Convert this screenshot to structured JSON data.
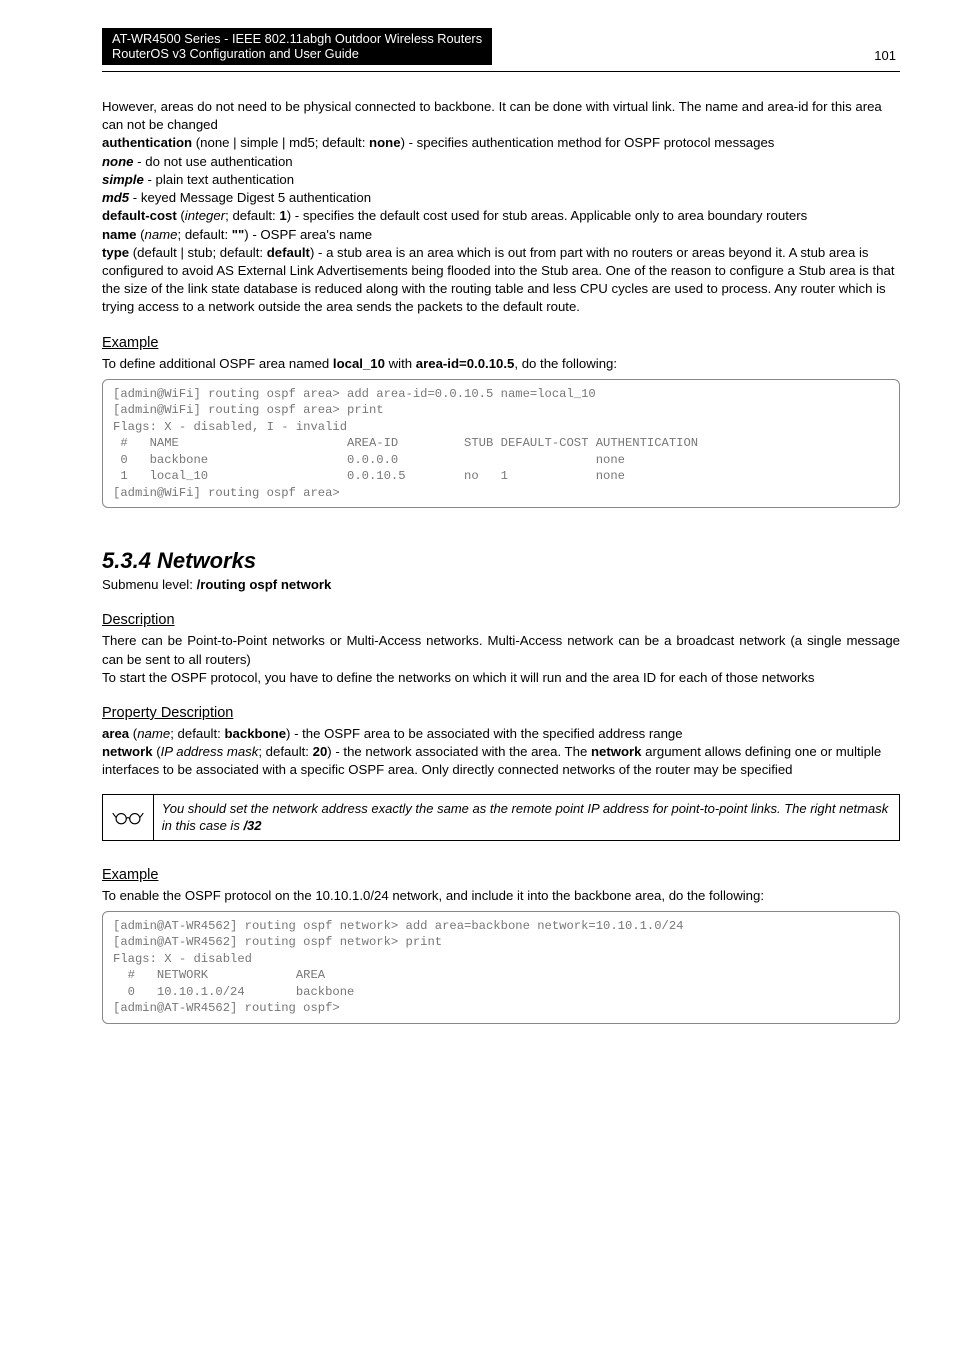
{
  "header": {
    "line1": "AT-WR4500 Series - IEEE 802.11abgh Outdoor Wireless Routers",
    "line2": "RouterOS v3 Configuration and User Guide",
    "page_number": "101"
  },
  "intro": {
    "p1": "However, areas do not need to be physical connected to backbone. It can be done with virtual link. The name and area-id for this area can not be changed",
    "auth_label": "authentication",
    "auth_rest": " (none | simple | md5; default: ",
    "auth_default": "none",
    "auth_tail": ") - specifies authentication method for OSPF protocol messages",
    "none_k": "none",
    "none_d": " - do not use authentication",
    "simple_k": "simple",
    "simple_d": " - plain text authentication",
    "md5_k": "md5",
    "md5_d": " - keyed Message Digest 5 authentication",
    "defcost_label": "default-cost",
    "defcost_mid1": " (",
    "defcost_type": "integer",
    "defcost_mid2": "; default: ",
    "defcost_def": "1",
    "defcost_tail": ") - specifies the default cost used for stub areas. Applicable only to area boundary routers",
    "name_label": "name",
    "name_mid1": " (",
    "name_type": "name",
    "name_mid2": "; default: ",
    "name_def": "\"\"",
    "name_tail": ") - OSPF area's name",
    "type_label": "type",
    "type_mid": " (default | stub; default: ",
    "type_def": "default",
    "type_tail": ") - a stub area is an area which is out from part with no routers or areas beyond it. A stub area is configured to avoid AS External Link Advertisements being flooded into the Stub area. One of the reason to configure a Stub area is that the size of the link state database is reduced along with the routing table and less CPU cycles are used to process. Any router which is trying access to a network outside the area sends the packets to the default route."
  },
  "example1": {
    "heading": "Example",
    "lead_a": "To define additional OSPF area named ",
    "lead_b": "local_10",
    "lead_c": " with ",
    "lead_d": "area-id=0.0.10.5",
    "lead_e": ", do the following:",
    "code": "[admin@WiFi] routing ospf area> add area-id=0.0.10.5 name=local_10\n[admin@WiFi] routing ospf area> print\nFlags: X - disabled, I - invalid\n #   NAME                       AREA-ID         STUB DEFAULT-COST AUTHENTICATION\n 0   backbone                   0.0.0.0                           none\n 1   local_10                   0.0.10.5        no   1            none\n[admin@WiFi] routing ospf area>"
  },
  "networks": {
    "title": "5.3.4  Networks",
    "sub_a": "Submenu level: ",
    "sub_b": "/routing ospf network",
    "desc_h": "Description",
    "desc_p1": "There can be Point-to-Point networks or Multi-Access networks. Multi-Access network can be a broadcast network (a single message can be sent to all routers)",
    "desc_p2": "To start the OSPF protocol, you have to define the networks on which it will run and the area ID for each of those networks",
    "prop_h": "Property Description",
    "area_label": "area",
    "area_mid1": " (",
    "area_type": "name",
    "area_mid2": "; default: ",
    "area_def": "backbone",
    "area_tail": ") - the OSPF area to be associated with the specified address range",
    "net_label": "network",
    "net_mid1": " (",
    "net_type": "IP address mask",
    "net_mid2": "; default: ",
    "net_def": "20",
    "net_mid3": ") - the network associated with the area. The ",
    "net_bold": "network",
    "net_tail": " argument allows defining one or multiple interfaces to be associated with a specific OSPF area. Only directly connected networks of the router may be specified"
  },
  "note": {
    "text_a": "You should set the network address exactly the same as the remote point IP address for point-to-point links. The right netmask in this case is ",
    "text_b": "/32"
  },
  "example2": {
    "heading": "Example",
    "lead": "To enable the OSPF protocol on the 10.10.1.0/24 network, and include it into the backbone area, do the following:",
    "code": "[admin@AT-WR4562] routing ospf network> add area=backbone network=10.10.1.0/24\n[admin@AT-WR4562] routing ospf network> print\nFlags: X - disabled\n  #   NETWORK            AREA\n  0   10.10.1.0/24       backbone\n[admin@AT-WR4562] routing ospf>"
  }
}
